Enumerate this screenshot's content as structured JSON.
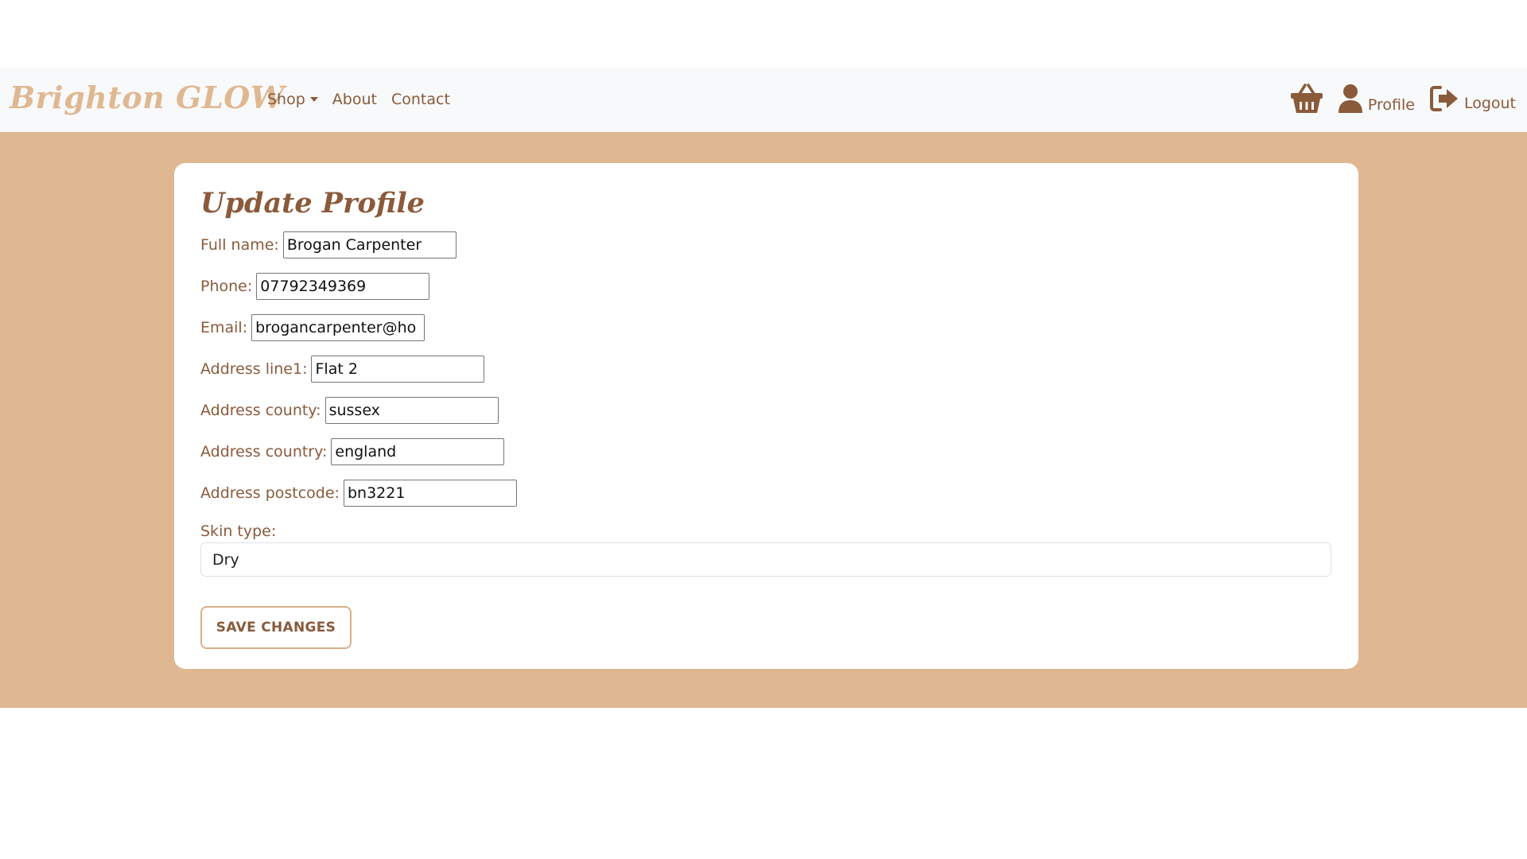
{
  "brand": {
    "name": "Brighton GLOW"
  },
  "nav": {
    "shop": "Shop",
    "about": "About",
    "contact": "Contact",
    "profile": "Profile",
    "logout": "Logout"
  },
  "icons": {
    "basket": "basket-icon",
    "profile": "user-icon",
    "logout": "sign-out-icon",
    "caret": "caret-down-icon"
  },
  "colors": {
    "brand": "#dfb892",
    "accent": "#8a5a3b",
    "band": "#dfb892",
    "navbar_bg": "#f8f9fa"
  },
  "form": {
    "title": "Update Profile",
    "full_name": {
      "label": "Full name:",
      "value": "Brogan Carpenter"
    },
    "phone": {
      "label": "Phone:",
      "value": "07792349369"
    },
    "email": {
      "label": "Email:",
      "value": "brogancarpenter@ho"
    },
    "address_line1": {
      "label": "Address line1:",
      "value": "Flat 2"
    },
    "address_county": {
      "label": "Address county:",
      "value": "sussex"
    },
    "address_country": {
      "label": "Address country:",
      "value": "england"
    },
    "address_postcode": {
      "label": "Address postcode:",
      "value": "bn3221"
    },
    "skin_type": {
      "label": "Skin type:",
      "selected": "Dry"
    },
    "save_label": "SAVE CHANGES"
  }
}
